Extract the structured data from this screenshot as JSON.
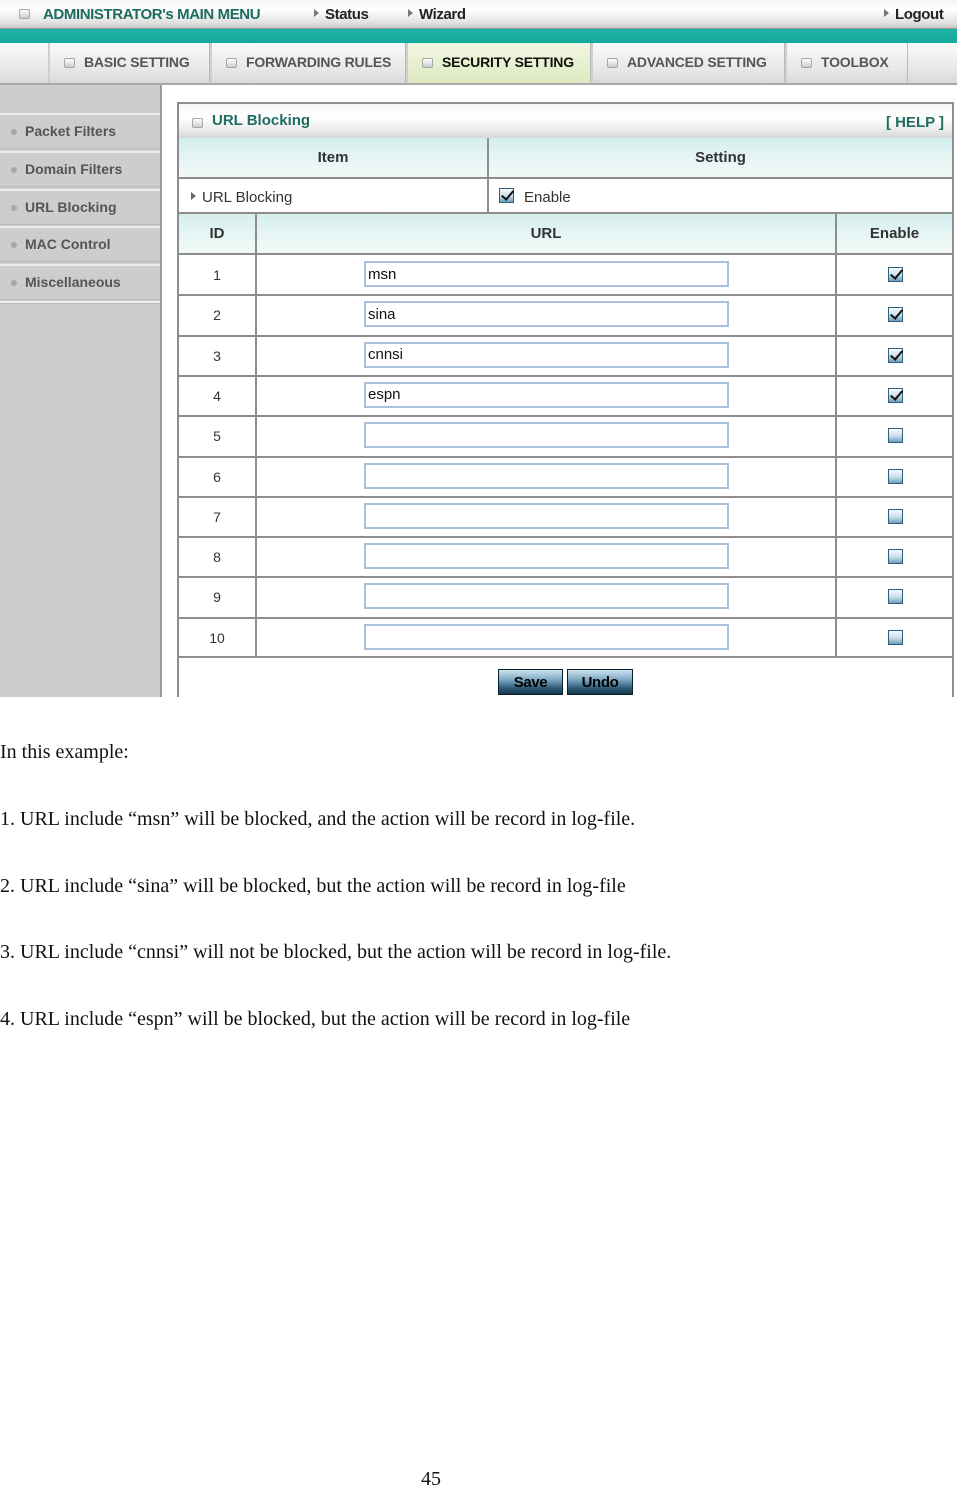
{
  "topbar": {
    "title": "ADMINISTRATOR's MAIN MENU",
    "status": "Status",
    "wizard": "Wizard",
    "logout": "Logout"
  },
  "tabs": [
    {
      "label": "BASIC SETTING",
      "active": false
    },
    {
      "label": "FORWARDING RULES",
      "active": false
    },
    {
      "label": "SECURITY SETTING",
      "active": true
    },
    {
      "label": "ADVANCED SETTING",
      "active": false
    },
    {
      "label": "TOOLBOX",
      "active": false
    }
  ],
  "sidebar": {
    "items": [
      {
        "label": "Packet Filters"
      },
      {
        "label": "Domain Filters"
      },
      {
        "label": "URL Blocking"
      },
      {
        "label": "MAC Control"
      },
      {
        "label": "Miscellaneous"
      }
    ]
  },
  "panel": {
    "title": "URL Blocking",
    "help": "[ HELP ]",
    "item_header": "Item",
    "setting_header": "Setting",
    "item_label": "URL Blocking",
    "enable_label": "Enable",
    "enable_checked": true,
    "col_id": "ID",
    "col_url": "URL",
    "col_enable": "Enable",
    "rows": [
      {
        "id": "1",
        "url": "msn",
        "enabled": true
      },
      {
        "id": "2",
        "url": "sina",
        "enabled": true
      },
      {
        "id": "3",
        "url": "cnnsi",
        "enabled": true
      },
      {
        "id": "4",
        "url": "espn",
        "enabled": true
      },
      {
        "id": "5",
        "url": "",
        "enabled": false
      },
      {
        "id": "6",
        "url": "",
        "enabled": false
      },
      {
        "id": "7",
        "url": "",
        "enabled": false
      },
      {
        "id": "8",
        "url": "",
        "enabled": false
      },
      {
        "id": "9",
        "url": "",
        "enabled": false
      },
      {
        "id": "10",
        "url": "",
        "enabled": false
      }
    ],
    "save": "Save",
    "undo": "Undo"
  },
  "colors": {
    "teal_bar": "#1aafa3",
    "title_green": "#1f6d60",
    "active_tab": "#dde9c0",
    "sidebar_bg": "#cdcdcd",
    "table_header": "#e3f3f2"
  },
  "document": {
    "intro": "In this example:",
    "points": [
      "1. URL include “msn” will be blocked, and the action will be record in log-file.",
      "2. URL include “sina” will be blocked, but the action will be record in log-file",
      "3. URL include “cnnsi” will not be blocked, but the action will be record in log-file.",
      "4. URL include “espn” will be blocked, but the action will be record in log-file"
    ],
    "page_number": "45"
  }
}
